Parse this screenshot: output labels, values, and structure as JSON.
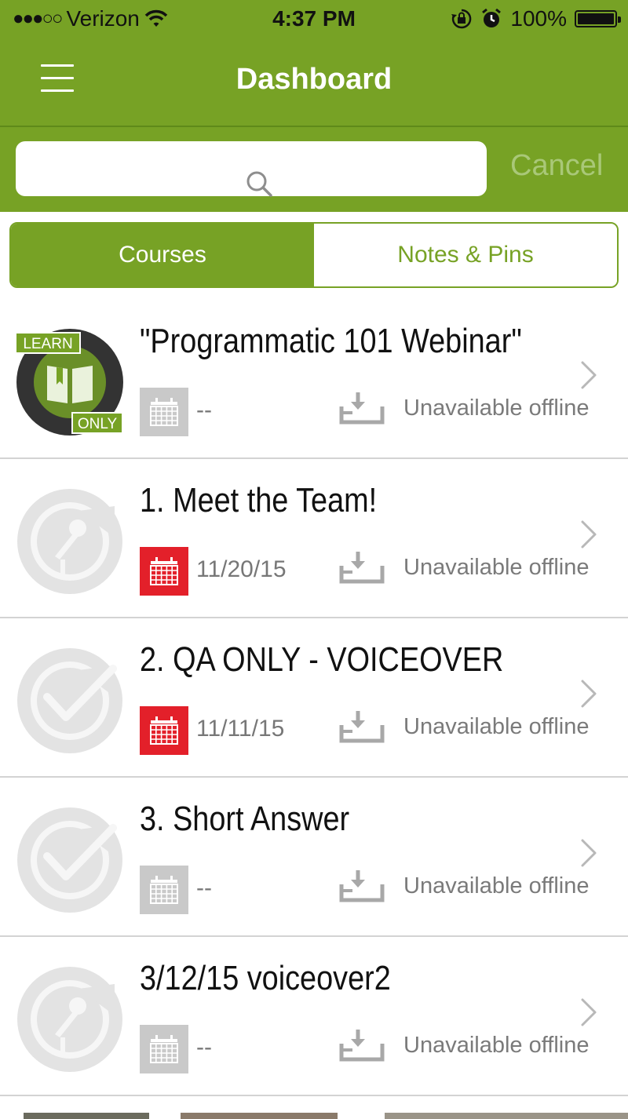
{
  "status_bar": {
    "carrier": "Verizon",
    "time": "4:37 PM",
    "battery": "100%"
  },
  "header": {
    "title": "Dashboard"
  },
  "search": {
    "placeholder": "",
    "cancel_label": "Cancel"
  },
  "tabs": [
    {
      "label": "Courses",
      "selected": true
    },
    {
      "label": "Notes & Pins",
      "selected": false
    }
  ],
  "colors": {
    "brand_green": "#77a225",
    "calendar_red": "#e3202a",
    "calendar_gray": "#c9c9c9"
  },
  "courses": [
    {
      "title": "\"Programmatic 101 Webinar\"",
      "date": "--",
      "offline_status": "Unavailable offline",
      "icon": "learn-only-badge-icon",
      "badge_top": "LEARN",
      "badge_bottom": "ONLY",
      "calendar": "gray"
    },
    {
      "title": "1. Meet the Team!",
      "date": "11/20/15",
      "offline_status": "Unavailable offline",
      "icon": "microphone-course-icon",
      "calendar": "red"
    },
    {
      "title": "2. QA ONLY - VOICEOVER",
      "date": "11/11/15",
      "offline_status": "Unavailable offline",
      "icon": "checkmark-course-icon",
      "calendar": "red"
    },
    {
      "title": "3. Short Answer",
      "date": "--",
      "offline_status": "Unavailable offline",
      "icon": "checkmark-course-icon",
      "calendar": "gray"
    },
    {
      "title": "3/12/15 voiceover2",
      "date": "--",
      "offline_status": "Unavailable offline",
      "icon": "microphone-course-icon",
      "calendar": "gray"
    }
  ]
}
